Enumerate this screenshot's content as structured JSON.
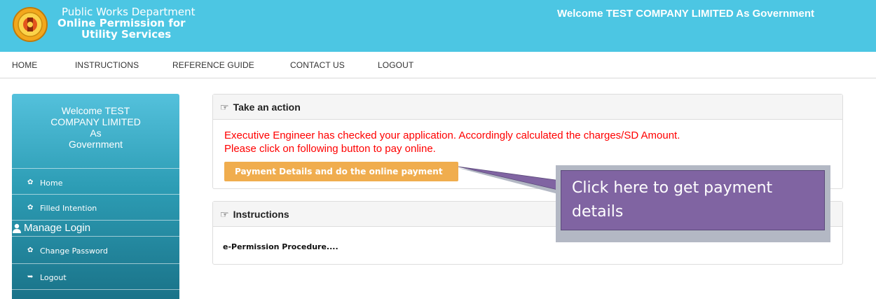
{
  "header": {
    "dept_line1": "Public Works Department",
    "dept_line2": "Online Permission for",
    "dept_line3": "Utility Services",
    "welcome": "Welcome TEST COMPANY LIMITED As Government"
  },
  "nav": {
    "items": [
      "HOME",
      "INSTRUCTIONS",
      "REFERENCE GUIDE",
      "CONTACT US",
      "LOGOUT"
    ]
  },
  "sidebar": {
    "welcome_line1": "Welcome TEST",
    "welcome_line2": "COMPANY LIMITED",
    "welcome_line3": "As",
    "welcome_line4": "Government",
    "home": "Home",
    "filled_intention": "Filled Intention",
    "manage_login": "Manage Login",
    "change_password": "Change Password",
    "logout": "Logout"
  },
  "action_panel": {
    "title": "Take an action",
    "message_line1": "Executive Engineer has checked your application. Accordingly calculated the charges/SD Amount.",
    "message_line2": "Please click on following button to pay online.",
    "button": "Payment Details and do the online payment"
  },
  "instructions_panel": {
    "title": "Instructions",
    "procedure": "e-Permission Procedure...."
  },
  "callout": {
    "line1": "Click here to get payment",
    "line2": "details"
  },
  "colors": {
    "header": "#4cc6e3",
    "button": "#f0ad4e",
    "message": "#ff0000",
    "callout": "#8064a2"
  }
}
